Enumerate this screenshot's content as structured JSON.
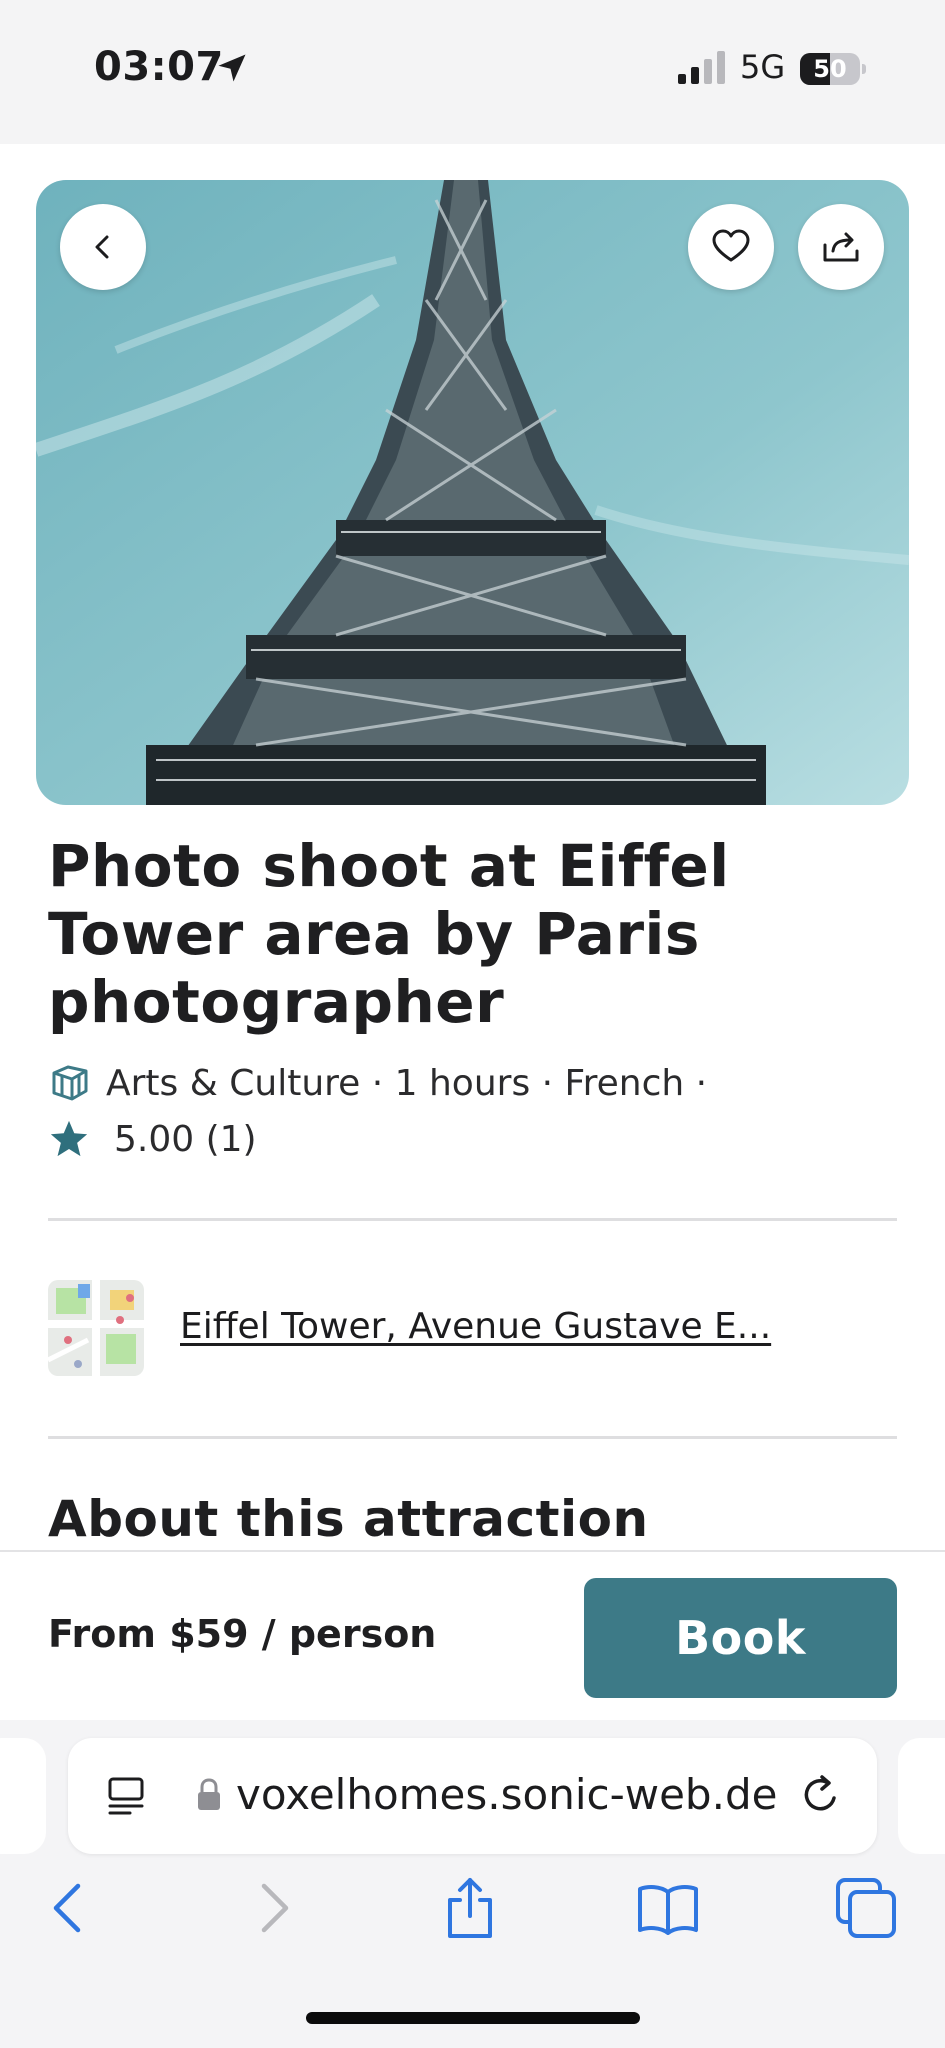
{
  "status_bar": {
    "time": "03:07",
    "network": "5G",
    "battery": "50",
    "battery_level": 0.5
  },
  "hero": {
    "image_alt": "Eiffel Tower",
    "sky_color": "#8ec6cd"
  },
  "listing": {
    "title": "Photo shoot at Eiffel Tower area by Paris photographer",
    "meta": "Arts & Culture · 1 hours · French ·",
    "rating": "5.00 (1)",
    "address": "Eiffel Tower, Avenue Gustave E...",
    "about_heading": "About this attraction"
  },
  "booking": {
    "price": "From $59 / person",
    "book_label": "Book",
    "accent": "#3d7a87"
  },
  "browser": {
    "url": "voxelhomes.sonic-web.de",
    "ui_color": "#2f76e0"
  },
  "icons": [
    "location-arrow-icon",
    "signal-icon",
    "battery-icon",
    "back-arrow-icon",
    "heart-icon",
    "share-icon",
    "category-icon",
    "star-icon",
    "map-thumbnail",
    "reader-mode-icon",
    "lock-icon",
    "reload-icon",
    "browser-back-icon",
    "browser-forward-icon",
    "browser-share-icon",
    "bookmarks-icon",
    "tabs-icon"
  ]
}
